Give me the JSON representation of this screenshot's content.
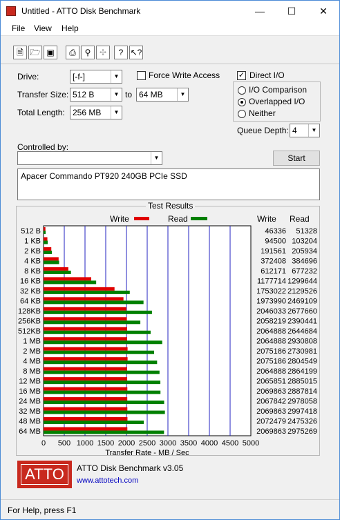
{
  "window": {
    "title": "Untitled - ATTO Disk Benchmark"
  },
  "menu": [
    "File",
    "View",
    "Help"
  ],
  "toolbar_icons": [
    "new-icon",
    "open-icon",
    "save-icon",
    "print-icon",
    "print-preview-icon",
    "move-icon",
    "help-icon",
    "context-help-icon"
  ],
  "settings": {
    "drive_label": "Drive:",
    "drive_value": "[-f-]",
    "force_write_label": "Force Write Access",
    "force_write_checked": false,
    "direct_io_label": "Direct I/O",
    "direct_io_checked": true,
    "transfer_size_label": "Transfer Size:",
    "transfer_from": "512 B",
    "to_label": "to",
    "transfer_to": "64 MB",
    "total_length_label": "Total Length:",
    "total_length": "256 MB",
    "io_comparison_label": "I/O Comparison",
    "overlapped_io_label": "Overlapped I/O",
    "neither_label": "Neither",
    "selected_mode": "Overlapped I/O",
    "queue_depth_label": "Queue Depth:",
    "queue_depth": "4",
    "controlled_by_label": "Controlled by:",
    "controlled_by_value": "",
    "start_label": "Start",
    "description": "Apacer Commando PT920 240GB PCIe SSD"
  },
  "results": {
    "group_title": "Test Results",
    "write_legend": "Write",
    "read_legend": "Read",
    "write_col": "Write",
    "read_col": "Read",
    "xlabel": "Transfer Rate - MB / Sec"
  },
  "chart_data": {
    "type": "bar",
    "orientation": "horizontal",
    "xlabel": "Transfer Rate - MB / Sec",
    "xlim": [
      0,
      5000
    ],
    "xticks": [
      0,
      500,
      1000,
      1500,
      2000,
      2500,
      3000,
      3500,
      4000,
      4500,
      5000
    ],
    "categories": [
      "512 B",
      "1 KB",
      "2 KB",
      "4 KB",
      "8 KB",
      "16 KB",
      "32 KB",
      "64 KB",
      "128KB",
      "256KB",
      "512KB",
      "1 MB",
      "2 MB",
      "4 MB",
      "8 MB",
      "12 MB",
      "16 MB",
      "24 MB",
      "32 MB",
      "48 MB",
      "64 MB"
    ],
    "series": [
      {
        "name": "Write",
        "color": "#e00000",
        "values_kb": [
          46336,
          94500,
          191561,
          372408,
          612171,
          1177714,
          1753022,
          1973990,
          2046033,
          2058219,
          2064888,
          2064888,
          2075186,
          2075186,
          2064888,
          2065851,
          2069863,
          2067842,
          2069863,
          2072479,
          2069863
        ]
      },
      {
        "name": "Read",
        "color": "#008000",
        "values_kb": [
          51328,
          103204,
          205934,
          384696,
          677232,
          1299644,
          2129526,
          2469109,
          2677660,
          2390441,
          2644684,
          2930808,
          2730981,
          2804549,
          2864199,
          2885015,
          2887814,
          2978058,
          2997418,
          2475326,
          2975269
        ]
      }
    ]
  },
  "brand": {
    "logo_text": "ATTO",
    "product": "ATTO Disk Benchmark v3.05",
    "url": "www.attotech.com"
  },
  "status": {
    "text": "For Help, press F1"
  }
}
